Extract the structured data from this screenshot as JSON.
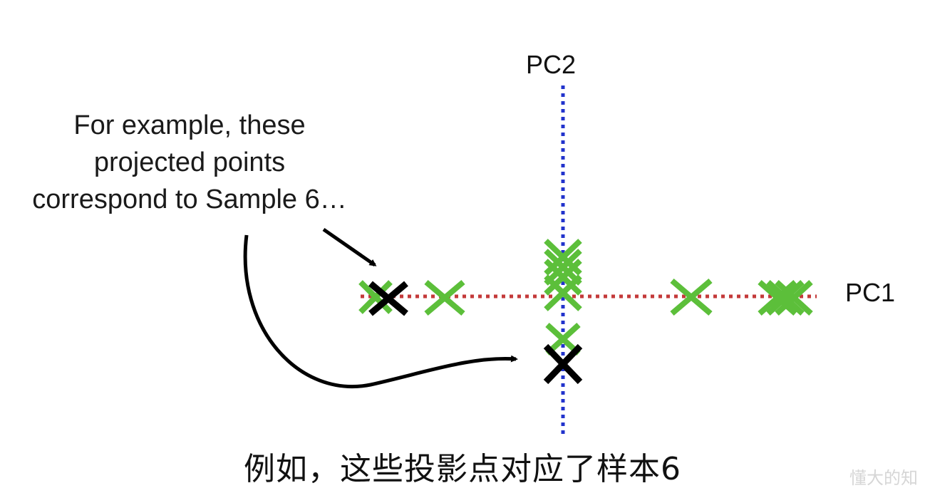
{
  "annotation": {
    "lines": [
      "For example, these",
      "projected points",
      "correspond to Sample 6…"
    ]
  },
  "axes": {
    "pc1_label": "PC1",
    "pc2_label": "PC2",
    "pc1_color": "#cc3333",
    "pc2_color": "#2233cc"
  },
  "points": {
    "projection_color": "#5cbf3a",
    "highlight_color": "#000000",
    "pc1_projections": [
      "pc1-proj-1",
      "pc1-proj-2",
      "pc1-proj-3",
      "pc1-proj-4",
      "pc1-proj-5",
      "pc1-proj-6",
      "pc1-proj-7"
    ],
    "pc2_projections": [
      "pc2-proj-1",
      "pc2-proj-2",
      "pc2-proj-3",
      "pc2-proj-4",
      "pc2-proj-5"
    ]
  },
  "subtitle": "例如，这些投影点对应了样本6",
  "watermark": "懂大的知"
}
